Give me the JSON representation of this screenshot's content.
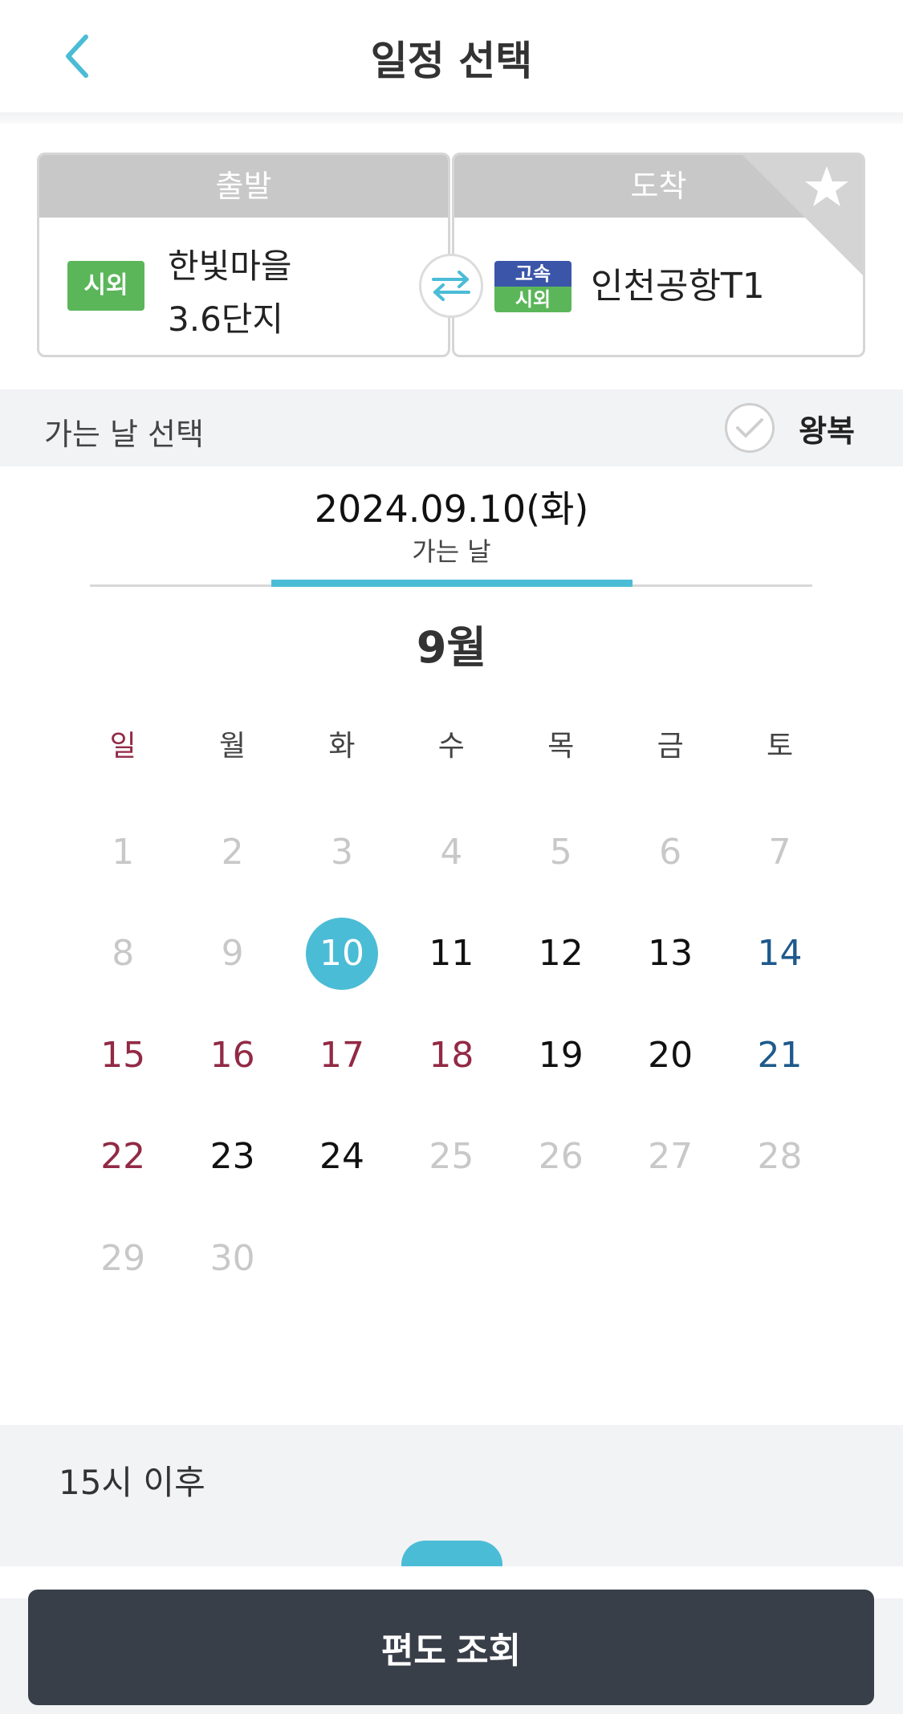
{
  "header": {
    "title": "일정 선택",
    "back_icon": "chevron-left-icon"
  },
  "route": {
    "departure": {
      "label": "출발",
      "badge": "시외",
      "place_line1": "한빛마을",
      "place_line2": "3.6단지"
    },
    "arrival": {
      "label": "도착",
      "badge_top": "고속",
      "badge_bottom": "시외",
      "place": "인천공항T1",
      "favorite_icon": "star-icon"
    },
    "swap_icon": "swap-arrows-icon"
  },
  "date_select": {
    "label": "가는 날 선택",
    "round_trip_label": "왕복",
    "check_icon": "check-icon"
  },
  "selected": {
    "date": "2024.09.10(화)",
    "sub_label": "가는 날"
  },
  "calendar": {
    "month": "9월",
    "weekdays": [
      "일",
      "월",
      "화",
      "수",
      "목",
      "금",
      "토"
    ],
    "weeks": [
      [
        "1",
        "2",
        "3",
        "4",
        "5",
        "6",
        "7"
      ],
      [
        "8",
        "9",
        "10",
        "11",
        "12",
        "13",
        "14"
      ],
      [
        "15",
        "16",
        "17",
        "18",
        "19",
        "20",
        "21"
      ],
      [
        "22",
        "23",
        "24",
        "25",
        "26",
        "27",
        "28"
      ],
      [
        "29",
        "30",
        "",
        "",
        "",
        "",
        ""
      ]
    ]
  },
  "time": {
    "label": "15시 이후"
  },
  "search_button": {
    "label": "편도 조회"
  },
  "colors": {
    "accent": "#4bbcd6",
    "holiday": "#922a45",
    "saturday": "#1e5a8c",
    "disabled": "#c8c8c8",
    "button": "#383f48",
    "badge_green": "#5bb65a",
    "badge_blue": "#3b55a8"
  }
}
